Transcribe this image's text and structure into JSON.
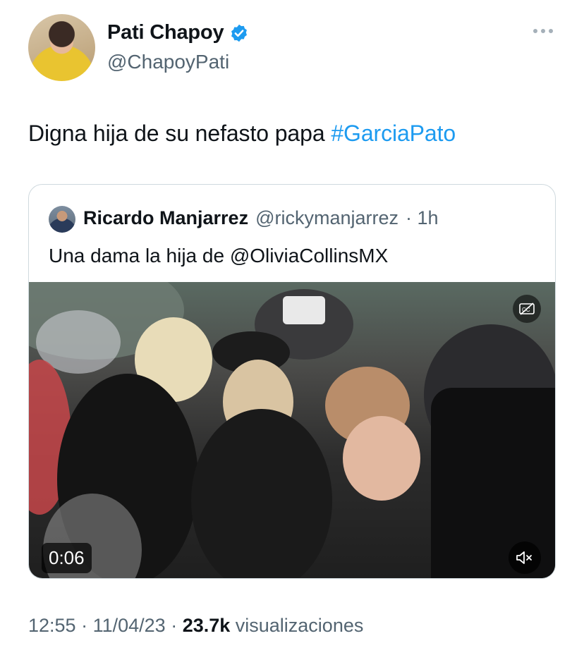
{
  "author": {
    "display_name": "Pati Chapoy",
    "handle": "@ChapoyPati",
    "verified": true
  },
  "tweet": {
    "text": "Digna hija de su nefasto papa ",
    "hashtag": "#GarciaPato"
  },
  "quoted_tweet": {
    "display_name": "Ricardo Manjarrez",
    "handle": "@rickymanjarrez",
    "time": "· 1h",
    "text": "Una dama la hija de @OliviaCollinsMX",
    "video": {
      "duration": "0:06",
      "muted": true
    }
  },
  "meta": {
    "time": "12:55",
    "sep1": " · ",
    "date": "11/04/23",
    "sep2": " · ",
    "views_count": "23.7k",
    "views_label": " visualizaciones"
  },
  "colors": {
    "accent": "#1d9bf0",
    "secondary_text": "#536471",
    "border": "#cfd9de"
  },
  "icons": [
    "verified-badge-icon",
    "more-options-icon",
    "closed-captions-icon",
    "mute-icon"
  ]
}
